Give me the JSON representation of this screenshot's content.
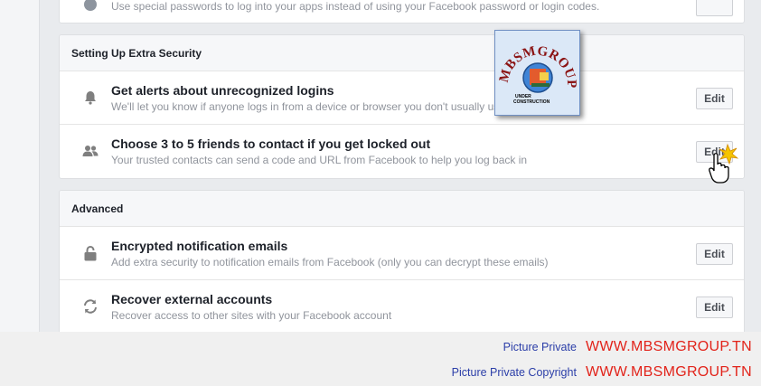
{
  "top_partial": {
    "description": "Use special passwords to log into your apps instead of using your Facebook password or login codes."
  },
  "extra_security": {
    "header": "Setting Up Extra Security",
    "rows": [
      {
        "title": "Get alerts about unrecognized logins",
        "description": "We'll let you know if anyone logs in from a device or browser you don't usually use",
        "button": "Edit",
        "icon": "bell-icon"
      },
      {
        "title": "Choose 3 to 5 friends to contact if you get locked out",
        "description": "Your trusted contacts can send a code and URL from Facebook to help you log back in",
        "button": "Edit",
        "icon": "friends-icon"
      }
    ]
  },
  "advanced": {
    "header": "Advanced",
    "rows": [
      {
        "title": "Encrypted notification emails",
        "description": "Add extra security to notification emails from Facebook (only you can decrypt these emails)",
        "button": "Edit",
        "icon": "lock-icon"
      },
      {
        "title": "Recover external accounts",
        "description": "Recover access to other sites with your Facebook account",
        "button": "Edit",
        "icon": "refresh-icon"
      }
    ]
  },
  "watermark": {
    "line1_label": "Picture Private",
    "line1_url": "WWW.MBSMGROUP.TN",
    "line2_label": "Picture Private Copyright",
    "line2_url": "WWW.MBSMGROUP.TN",
    "logo_text": "MBSMGROUP",
    "logo_sub1": "UNDER",
    "logo_sub2": "CONSTRUCTION"
  },
  "colors": {
    "watermark_label": "#2b3ea8",
    "watermark_url": "#e2231a"
  }
}
